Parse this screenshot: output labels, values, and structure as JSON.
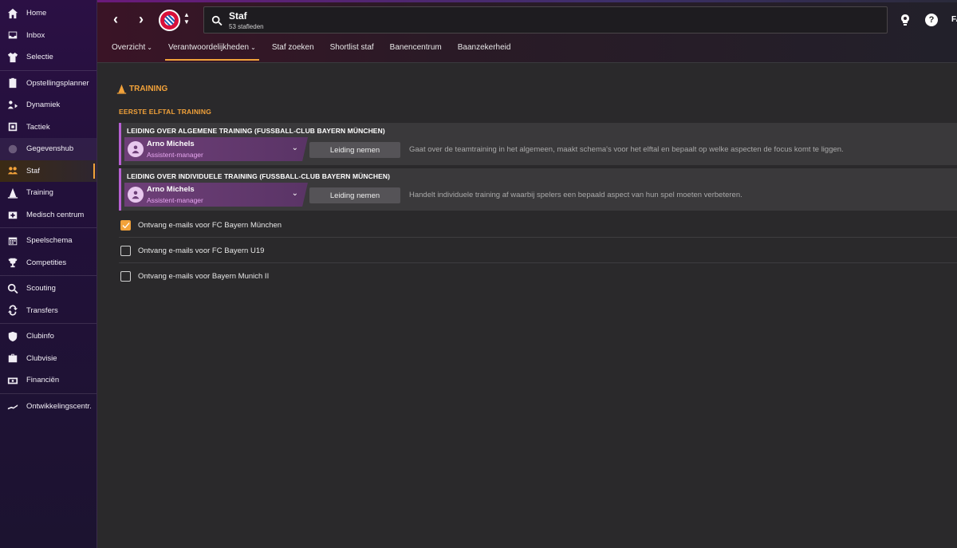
{
  "sidebar": {
    "groups": [
      [
        {
          "label": "Home",
          "icon": "home-icon"
        },
        {
          "label": "Inbox",
          "icon": "inbox-icon"
        },
        {
          "label": "Selectie",
          "icon": "shirt-icon"
        }
      ],
      [
        {
          "label": "Opstellingsplanner",
          "icon": "clipboard-icon"
        },
        {
          "label": "Dynamiek",
          "icon": "dynamics-icon"
        },
        {
          "label": "Tactiek",
          "icon": "tactics-icon"
        },
        {
          "label": "Gegevenshub",
          "icon": "data-hub-icon"
        },
        {
          "label": "Staf",
          "icon": "staff-icon"
        },
        {
          "label": "Training",
          "icon": "training-cone-icon"
        },
        {
          "label": "Medisch centrum",
          "icon": "medical-icon"
        }
      ],
      [
        {
          "label": "Speelschema",
          "icon": "calendar-icon"
        },
        {
          "label": "Competities",
          "icon": "trophy-icon"
        }
      ],
      [
        {
          "label": "Scouting",
          "icon": "scouting-icon"
        },
        {
          "label": "Transfers",
          "icon": "transfers-icon"
        }
      ],
      [
        {
          "label": "Clubinfo",
          "icon": "shield-icon"
        },
        {
          "label": "Clubvisie",
          "icon": "briefcase-icon"
        },
        {
          "label": "Financiën",
          "icon": "finances-icon"
        }
      ],
      [
        {
          "label": "Ontwikkelingscentr.",
          "icon": "development-icon"
        }
      ]
    ],
    "active": "Staf"
  },
  "header": {
    "title": "Staf",
    "subtitle": "53 stafleden",
    "right_label": "FA",
    "tabs": [
      {
        "label": "Overzicht",
        "dropdown": true
      },
      {
        "label": "Verantwoordelijkheden",
        "dropdown": true,
        "active": true
      },
      {
        "label": "Staf zoeken",
        "dropdown": false
      },
      {
        "label": "Shortlist staf",
        "dropdown": false
      },
      {
        "label": "Banencentrum",
        "dropdown": false
      },
      {
        "label": "Baanzekerheid",
        "dropdown": false
      }
    ]
  },
  "main": {
    "section_title": "TRAINING",
    "subsection_title": "EERSTE ELFTAL TRAINING",
    "responsibilities": [
      {
        "title": "LEIDING OVER ALGEMENE TRAINING (FUSSBALL-CLUB BAYERN MÜNCHEN)",
        "person_name": "Arno Michels",
        "person_role": "Assistent-manager",
        "button": "Leiding nemen",
        "description": "Gaat over de teamtraining in het algemeen, maakt schema's voor het elftal en bepaalt op welke aspecten de focus komt te liggen."
      },
      {
        "title": "LEIDING OVER INDIVIDUELE TRAINING (FUSSBALL-CLUB BAYERN MÜNCHEN)",
        "person_name": "Arno Michels",
        "person_role": "Assistent-manager",
        "button": "Leiding nemen",
        "description": "Handelt individuele training af waarbij spelers een bepaald aspect van hun spel moeten verbeteren."
      }
    ],
    "email_options": [
      {
        "label": "Ontvang e-mails voor FC Bayern München",
        "checked": true
      },
      {
        "label": "Ontvang e-mails voor FC Bayern U19",
        "checked": false
      },
      {
        "label": "Ontvang e-mails voor Bayern Munich II",
        "checked": false
      }
    ]
  },
  "colors": {
    "accent": "#f2a23a",
    "sidebar_bg": "#2b1044",
    "person_select": "#6e3f78",
    "role_text": "#e7a6f0"
  }
}
